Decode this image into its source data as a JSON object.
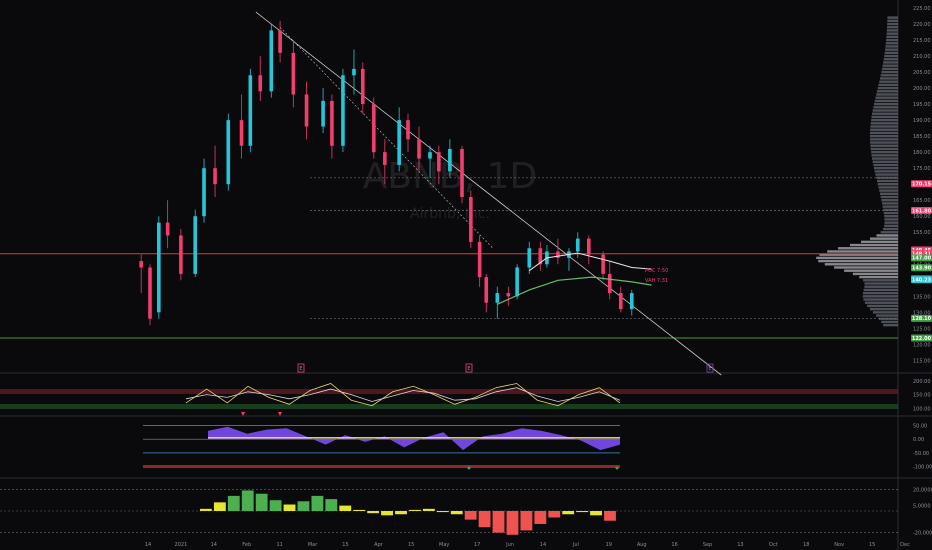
{
  "watermark": {
    "symbol": "ABNB, 1D",
    "company": "Airbnb, Inc."
  },
  "colors": {
    "background": "#0a0a0d",
    "bull": "#26c6da",
    "bear": "#f23d6d",
    "resistance": "#e53935",
    "support": "#43a047",
    "vwap": "#66bb6a",
    "stoch_k": "#f5d76e",
    "stoch_d": "#d8d8d8",
    "wave_fill": "#7b4df5",
    "wave_pos": "#f6e58d",
    "macd_bull": "#4caf50",
    "macd_bear": "#ef5350",
    "macd_neutral": "#e6e62e"
  },
  "annotations": {
    "poc": "POC 7:50",
    "vah": "VAH 7:31"
  },
  "event_markers": [
    "E",
    "E",
    "E"
  ],
  "chart_data": [
    {
      "type": "candlestick",
      "title": "ABNB, 1D",
      "subtitle": "Airbnb, Inc.",
      "ylim": [
        112,
        225
      ],
      "x_tick_labels": [
        "14",
        "2021",
        "14",
        "Feb",
        "11",
        "Mar",
        "15",
        "Apr",
        "15",
        "May",
        "17",
        "Jun",
        "14",
        "Jul",
        "19",
        "Aug",
        "16",
        "Sep",
        "13",
        "Oct",
        "18",
        "Nov",
        "15",
        "Dec"
      ],
      "y_tick_labels": [
        "225.00",
        "220.00",
        "215.00",
        "210.00",
        "205.00",
        "200.00",
        "195.00",
        "190.00",
        "185.00",
        "180.00",
        "175.00",
        "170.00",
        "165.00",
        "160.00",
        "155.00",
        "150.00",
        "145.00",
        "140.00",
        "135.00",
        "130.00",
        "125.00",
        "120.00",
        "115.00"
      ],
      "price_levels": [
        {
          "label": "170.15",
          "value": 170.15,
          "color": "#f23d6d"
        },
        {
          "label": "161.80",
          "value": 161.8,
          "color": "#f23d6d"
        },
        {
          "label": "149.45",
          "value": 149.45,
          "color": "#f23d6d"
        },
        {
          "label": "148.31",
          "value": 148.31,
          "color": "#f23d6d"
        },
        {
          "label": "147.00",
          "value": 147.0,
          "color": "#43a047"
        },
        {
          "label": "143.90",
          "value": 143.9,
          "color": "#43a047"
        },
        {
          "label": "140.47",
          "value": 140.47,
          "color": "#f23d6d"
        },
        {
          "label": "140.23",
          "value": 140.23,
          "color": "#26c6da"
        },
        {
          "label": "128.10",
          "value": 128.1,
          "color": "#43a047"
        },
        {
          "label": "122.00",
          "value": 122.0,
          "color": "#43a047"
        }
      ],
      "horizontal_lines": [
        {
          "name": "resistance",
          "value": 148.3,
          "style": "solid"
        },
        {
          "name": "support",
          "value": 122.0,
          "style": "solid"
        },
        {
          "name": "dotted-172",
          "value": 172.0,
          "style": "dotted"
        },
        {
          "name": "dotted-161",
          "value": 161.8,
          "style": "dotted"
        },
        {
          "name": "dotted-128",
          "value": 128.1,
          "style": "dotted"
        }
      ],
      "trendline": {
        "from": [
          "Feb 11",
          220
        ],
        "to": [
          "Aug 20",
          112
        ]
      },
      "candles": [
        {
          "date": "Dec 10",
          "open": 146,
          "high": 148,
          "low": 136,
          "close": 144
        },
        {
          "date": "Dec 14",
          "open": 144,
          "high": 145,
          "low": 126,
          "close": 128
        },
        {
          "date": "Dec 18",
          "open": 130,
          "high": 160,
          "low": 128,
          "close": 158
        },
        {
          "date": "Dec 22",
          "open": 158,
          "high": 165,
          "low": 150,
          "close": 154
        },
        {
          "date": "Dec 28",
          "open": 154,
          "high": 156,
          "low": 140,
          "close": 142
        },
        {
          "date": "Jan 4",
          "open": 142,
          "high": 162,
          "low": 141,
          "close": 160
        },
        {
          "date": "Jan 8",
          "open": 160,
          "high": 178,
          "low": 158,
          "close": 175
        },
        {
          "date": "Jan 13",
          "open": 175,
          "high": 182,
          "low": 166,
          "close": 170
        },
        {
          "date": "Jan 19",
          "open": 170,
          "high": 192,
          "low": 168,
          "close": 190
        },
        {
          "date": "Jan 25",
          "open": 190,
          "high": 198,
          "low": 178,
          "close": 182
        },
        {
          "date": "Jan 29",
          "open": 182,
          "high": 206,
          "low": 180,
          "close": 204
        },
        {
          "date": "Feb 3",
          "open": 204,
          "high": 210,
          "low": 196,
          "close": 199
        },
        {
          "date": "Feb 8",
          "open": 199,
          "high": 220,
          "low": 197,
          "close": 218
        },
        {
          "date": "Feb 12",
          "open": 218,
          "high": 221,
          "low": 208,
          "close": 211
        },
        {
          "date": "Feb 18",
          "open": 211,
          "high": 215,
          "low": 194,
          "close": 198
        },
        {
          "date": "Feb 24",
          "open": 198,
          "high": 202,
          "low": 184,
          "close": 188
        },
        {
          "date": "Mar 1",
          "open": 188,
          "high": 200,
          "low": 186,
          "close": 196
        },
        {
          "date": "Mar 5",
          "open": 196,
          "high": 198,
          "low": 178,
          "close": 182
        },
        {
          "date": "Mar 10",
          "open": 182,
          "high": 206,
          "low": 180,
          "close": 204
        },
        {
          "date": "Mar 15",
          "open": 204,
          "high": 212,
          "low": 198,
          "close": 206
        },
        {
          "date": "Mar 19",
          "open": 206,
          "high": 208,
          "low": 192,
          "close": 195
        },
        {
          "date": "Mar 24",
          "open": 195,
          "high": 197,
          "low": 178,
          "close": 180
        },
        {
          "date": "Mar 29",
          "open": 180,
          "high": 184,
          "low": 170,
          "close": 176
        },
        {
          "date": "Apr 5",
          "open": 176,
          "high": 194,
          "low": 174,
          "close": 190
        },
        {
          "date": "Apr 9",
          "open": 190,
          "high": 192,
          "low": 180,
          "close": 184
        },
        {
          "date": "Apr 14",
          "open": 184,
          "high": 188,
          "low": 174,
          "close": 178
        },
        {
          "date": "Apr 19",
          "open": 178,
          "high": 182,
          "low": 172,
          "close": 180
        },
        {
          "date": "Apr 23",
          "open": 180,
          "high": 182,
          "low": 170,
          "close": 174
        },
        {
          "date": "Apr 28",
          "open": 174,
          "high": 184,
          "low": 172,
          "close": 181
        },
        {
          "date": "May 3",
          "open": 181,
          "high": 182,
          "low": 164,
          "close": 166
        },
        {
          "date": "May 7",
          "open": 166,
          "high": 168,
          "low": 150,
          "close": 152
        },
        {
          "date": "May 11",
          "open": 152,
          "high": 154,
          "low": 138,
          "close": 141
        },
        {
          "date": "May 14",
          "open": 141,
          "high": 142,
          "low": 130,
          "close": 133
        },
        {
          "date": "May 19",
          "open": 133,
          "high": 138,
          "low": 128,
          "close": 136
        },
        {
          "date": "May 24",
          "open": 136,
          "high": 138,
          "low": 132,
          "close": 135
        },
        {
          "date": "May 28",
          "open": 135,
          "high": 145,
          "low": 134,
          "close": 144
        },
        {
          "date": "Jun 3",
          "open": 144,
          "high": 152,
          "low": 142,
          "close": 150
        },
        {
          "date": "Jun 8",
          "open": 150,
          "high": 152,
          "low": 143,
          "close": 145
        },
        {
          "date": "Jun 11",
          "open": 145,
          "high": 151,
          "low": 144,
          "close": 149
        },
        {
          "date": "Jun 16",
          "open": 149,
          "high": 153,
          "low": 145,
          "close": 147
        },
        {
          "date": "Jun 21",
          "open": 147,
          "high": 150,
          "low": 143,
          "close": 149
        },
        {
          "date": "Jun 25",
          "open": 149,
          "high": 155,
          "low": 147,
          "close": 153
        },
        {
          "date": "Jun 30",
          "open": 153,
          "high": 154,
          "low": 145,
          "close": 148
        },
        {
          "date": "Jul 6",
          "open": 148,
          "high": 149,
          "low": 140,
          "close": 142
        },
        {
          "date": "Jul 9",
          "open": 142,
          "high": 146,
          "low": 134,
          "close": 136
        },
        {
          "date": "Jul 14",
          "open": 136,
          "high": 138,
          "low": 130,
          "close": 131
        },
        {
          "date": "Jul 19",
          "open": 131,
          "high": 137,
          "low": 129,
          "close": 136
        }
      ]
    },
    {
      "type": "line",
      "title": "Stochastic RSI",
      "ylim": [
        80,
        210
      ],
      "y_tick_labels": [
        "200.00",
        "150.00",
        "100.00"
      ],
      "series": [
        {
          "values": [
            120,
            170,
            120,
            180,
            140,
            115,
            165,
            190,
            130,
            110,
            160,
            180,
            150,
            115,
            140,
            175,
            190,
            130,
            110,
            150,
            175,
            120
          ]
        },
        {
          "values": [
            135,
            150,
            140,
            160,
            150,
            135,
            150,
            170,
            150,
            125,
            145,
            165,
            155,
            130,
            135,
            160,
            175,
            145,
            125,
            140,
            160,
            130
          ]
        }
      ]
    },
    {
      "type": "area",
      "title": "Wave Trend",
      "ylim": [
        -120,
        70
      ],
      "y_tick_labels": [
        "50.00",
        "0.00",
        "-50.00",
        "-100.00"
      ],
      "values": [
        30,
        45,
        20,
        35,
        40,
        10,
        -20,
        15,
        -10,
        10,
        -30,
        5,
        25,
        -40,
        10,
        20,
        40,
        30,
        15,
        -5,
        -40,
        -20
      ]
    },
    {
      "type": "bar",
      "title": "Momentum",
      "ylim": [
        -25000,
        25000
      ],
      "y_tick_labels": [
        "20,0000",
        "5,0000",
        "-20,0000"
      ],
      "values": [
        2000,
        8000,
        14000,
        19000,
        16000,
        10000,
        6000,
        9000,
        14000,
        11000,
        5000,
        1000,
        -2000,
        -4000,
        -3000,
        1000,
        2000,
        -1000,
        -3000,
        -8000,
        -15000,
        -20000,
        -22000,
        -18000,
        -12000,
        -6000,
        -3000,
        -1000,
        -4000,
        -9000
      ]
    }
  ]
}
